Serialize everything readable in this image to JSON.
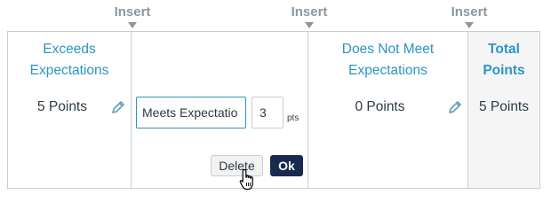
{
  "insert_labels": [
    "Insert",
    "Insert",
    "Insert"
  ],
  "ratings": [
    {
      "title": "Exceeds Expectations",
      "points": "5 Points"
    },
    {
      "title": "Does Not Meet Expectations",
      "points": "0 Points"
    }
  ],
  "editing": {
    "name_value": "Meets Expectatio",
    "points_value": "3",
    "pts_label": "pts",
    "delete_label": "Delete",
    "ok_label": "Ok"
  },
  "total": {
    "title": "Total Points",
    "points": "5 Points"
  },
  "colors": {
    "accent": "#2b95c4",
    "ok_button": "#1a2a4f",
    "insert": "#8b969e"
  },
  "icons": [
    "pencil-icon",
    "hand-pointer-cursor"
  ]
}
